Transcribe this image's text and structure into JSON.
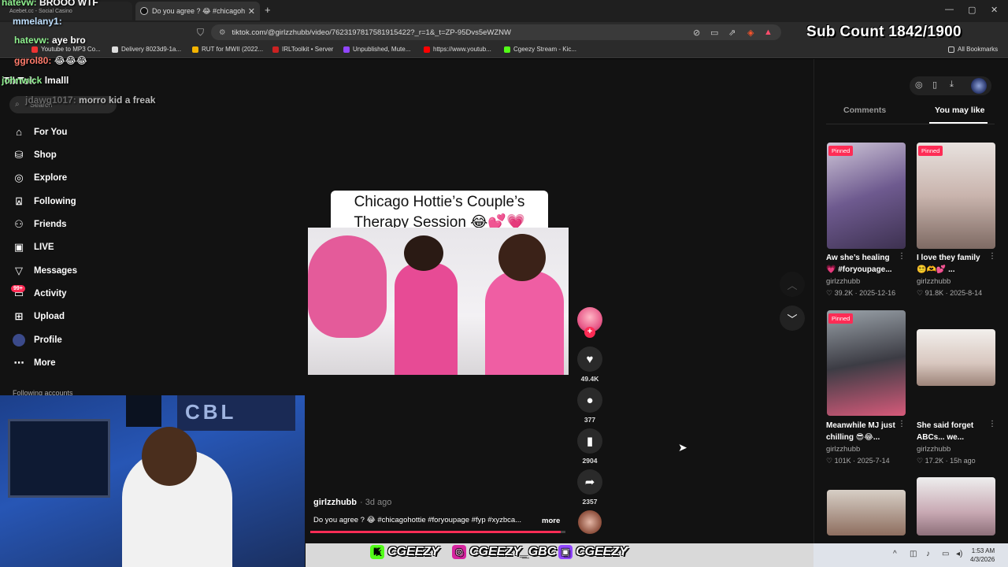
{
  "browser": {
    "tabs": [
      {
        "title": "Acebet.cc - Social Casino"
      },
      {
        "title": "Do you agree ? 😂 #chicagoh"
      }
    ],
    "url": "tiktok.com/@girlzzhubb/video/7623197817581915422?_r=1&_t=ZP-95Dvs5eWZNW",
    "bookmarks": [
      {
        "label": "Youtube to MP3 Co...",
        "color": "#e33"
      },
      {
        "label": "Delivery 8023d9-1a...",
        "color": "#ddd"
      },
      {
        "label": "RUT for MWII (2022...",
        "color": "#f4b400"
      },
      {
        "label": "IRLToolkit • Server",
        "color": "#c22"
      },
      {
        "label": "Unpublished, Mute...",
        "color": "#9146ff"
      },
      {
        "label": "https://www.youtub...",
        "color": "#f00"
      },
      {
        "label": "Cgeezy Stream - Kic...",
        "color": "#53fc18"
      }
    ],
    "all_bookmarks": "All Bookmarks"
  },
  "overlay": {
    "sub_count": "Sub Count  1842/1900",
    "chat": [
      {
        "user": "hatevw:",
        "msg": "BROOO WTF"
      },
      {
        "user": "mmelany1:",
        "msg": ""
      },
      {
        "user": "hatevw:",
        "msg": "aye bro"
      },
      {
        "user": "ggrol80:",
        "msg": "😂😂😂"
      },
      {
        "user": "johnwick",
        "msg": "lmalll"
      },
      {
        "user": "jdawg1017:",
        "msg": "morro kid a freak"
      }
    ],
    "socials": [
      "CGEEZY",
      "CGEEZY_GBC",
      "CGEEZY"
    ],
    "clock_time": "1:53 AM",
    "clock_date": "4/3/2026"
  },
  "tiktok": {
    "logo": "TikTok",
    "search_placeholder": "Search",
    "nav": [
      {
        "label": "For You",
        "icon": "home-icon"
      },
      {
        "label": "Shop",
        "icon": "shop-icon"
      },
      {
        "label": "Explore",
        "icon": "compass-icon"
      },
      {
        "label": "Following",
        "icon": "following-icon"
      },
      {
        "label": "Friends",
        "icon": "friends-icon"
      },
      {
        "label": "LIVE",
        "icon": "live-icon"
      },
      {
        "label": "Messages",
        "icon": "messages-icon"
      },
      {
        "label": "Activity",
        "icon": "activity-icon"
      },
      {
        "label": "Upload",
        "icon": "upload-icon"
      },
      {
        "label": "Profile",
        "icon": "profile-icon"
      },
      {
        "label": "More",
        "icon": "more-icon"
      }
    ],
    "activity_badge": "99+",
    "following_accounts": "Following accounts",
    "video": {
      "caption_line1": "Chicago Hottie’s Couple’s",
      "caption_line2": "Therapy Session 😂💕💗",
      "author": "girlzzhubb",
      "ago": "· 3d ago",
      "description": "Do you agree ? 😂 #chicagohottie #foryoupage #fyp #xyzbca...",
      "more": "more",
      "likes": "49.4K",
      "comments": "377",
      "saves": "2904",
      "shares": "2357",
      "progress": 0.98
    },
    "right_tabs": {
      "comments": "Comments",
      "you_may_like": "You may like"
    },
    "cards": [
      {
        "title": "Aw she’s healing 💗 #foryoupage...",
        "author": "girlzzhubb",
        "likes": "39.2K",
        "date": "2025-12-16",
        "pinned": "Pinned"
      },
      {
        "title": "I love they family 😵‍💫🫶💕 ...",
        "author": "girlzzhubb",
        "likes": "91.8K",
        "date": "2025-8-14",
        "pinned": "Pinned"
      },
      {
        "title": "Meanwhile MJ just chilling 😎😂...",
        "author": "girlzzhubb",
        "likes": "101K",
        "date": "2025-7-14",
        "pinned": "Pinned"
      },
      {
        "title": "She said forget ABCs... we...",
        "author": "girlzzhubb",
        "likes": "17.2K",
        "date": "15h ago",
        "pinned": ""
      }
    ]
  }
}
